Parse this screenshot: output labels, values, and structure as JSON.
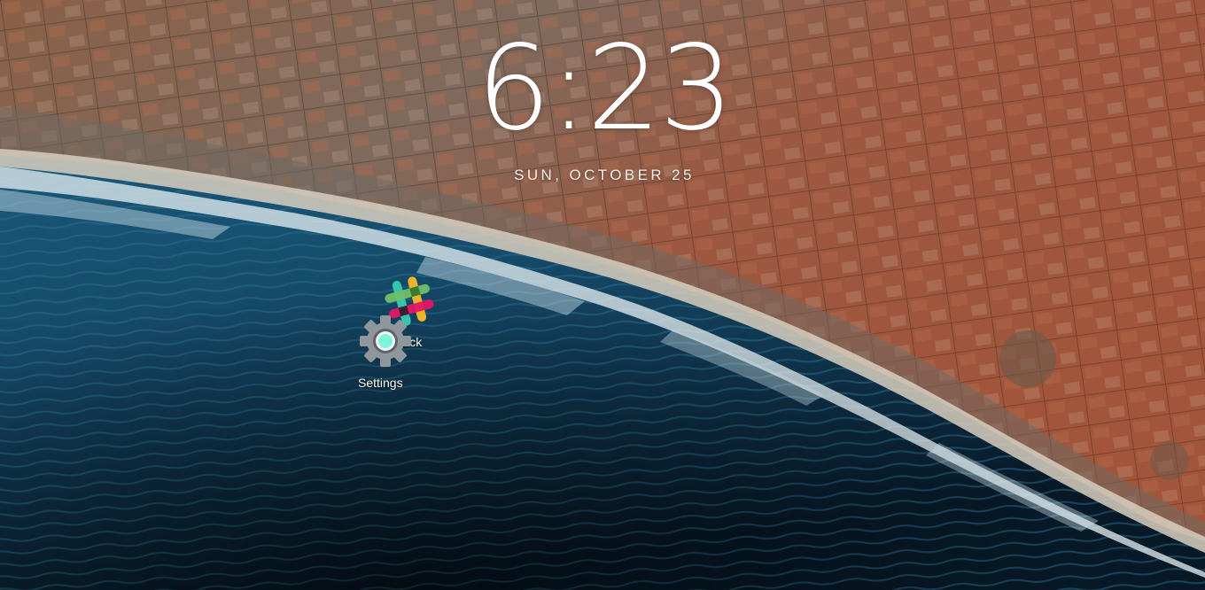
{
  "lockscreen": {
    "time": "6:23",
    "date": "SUN, OCTOBER 25"
  },
  "desktop_icons": [
    {
      "label": "Slack",
      "icon": "slack-icon"
    },
    {
      "label": "Settings",
      "icon": "gear-icon"
    }
  ],
  "colors": {
    "ocean": "#174e6e",
    "land": "#9a4f36",
    "slack_teal": "#36c5ab",
    "slack_pink": "#e01765",
    "slack_green": "#6ec06c",
    "slack_yellow": "#ecb32d",
    "gear": "#8f969c",
    "gear_accent": "#7ef4df"
  }
}
